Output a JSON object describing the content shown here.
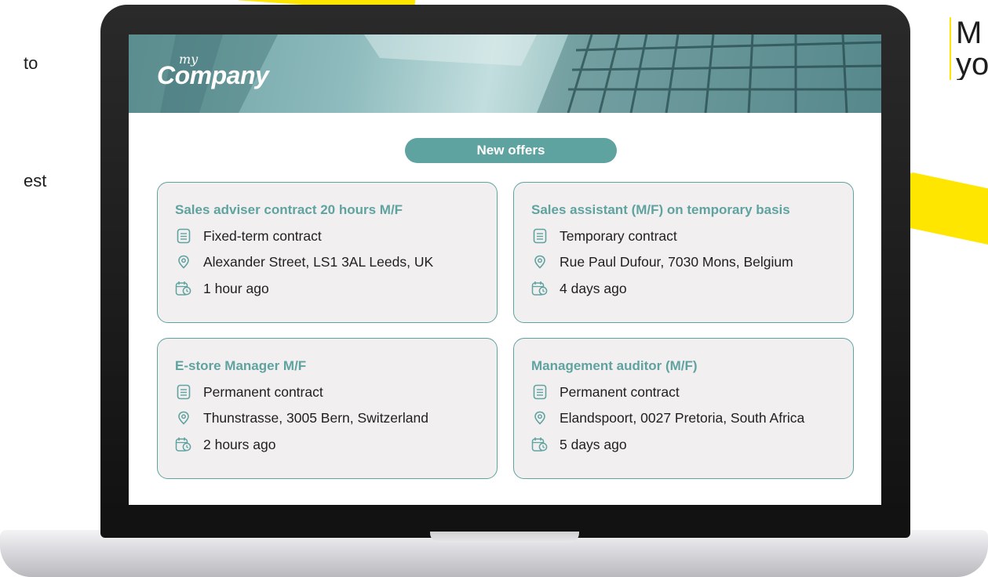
{
  "background": {
    "left_text_1": "to",
    "left_text_2": "est",
    "right_line_1": "M",
    "right_line_2": "yo"
  },
  "brand": {
    "logo_small": "my",
    "logo_main": "Company",
    "accent_color": "#5fa3a0"
  },
  "section": {
    "title": "New offers"
  },
  "offers": [
    {
      "title": "Sales adviser contract 20 hours M/F",
      "contract": "Fixed-term contract",
      "location": "Alexander Street, LS1 3AL Leeds, UK",
      "posted": "1 hour ago"
    },
    {
      "title": "Sales assistant (M/F) on temporary basis",
      "contract": "Temporary contract",
      "location": "Rue Paul Dufour, 7030 Mons, Belgium",
      "posted": "4 days ago"
    },
    {
      "title": "E-store Manager M/F",
      "contract": "Permanent contract",
      "location": "Thunstrasse, 3005 Bern, Switzerland",
      "posted": "2 hours ago"
    },
    {
      "title": "Management auditor (M/F)",
      "contract": "Permanent contract",
      "location": "Elandspoort, 0027 Pretoria, South Africa",
      "posted": "5 days ago"
    }
  ],
  "icons": {
    "contract": "contract-list-icon",
    "location": "location-pin-icon",
    "posted": "calendar-clock-icon"
  }
}
